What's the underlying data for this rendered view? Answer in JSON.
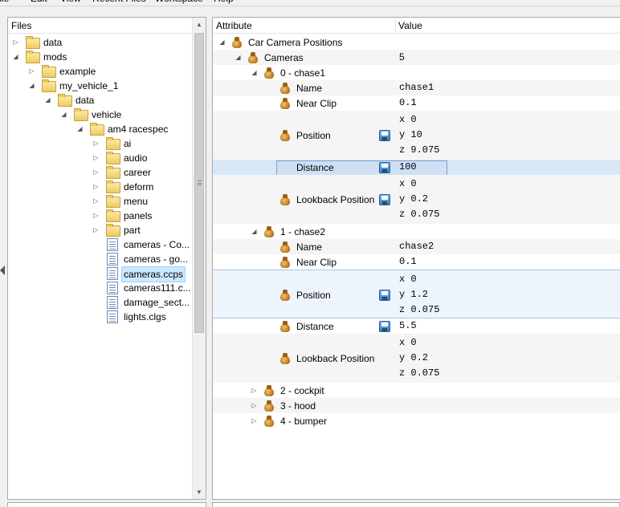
{
  "menu": [
    "File",
    "Edit",
    "View",
    "Recent Files",
    "Workspace",
    "Help"
  ],
  "files_panel": {
    "title": "Files",
    "items": [
      {
        "label": "data",
        "type": "folder",
        "expander": "collapsed"
      },
      {
        "label": "mods",
        "type": "folder",
        "expander": "expanded"
      },
      {
        "label": "example",
        "type": "folder",
        "expander": "collapsed"
      },
      {
        "label": "my_vehicle_1",
        "type": "folder",
        "expander": "expanded"
      },
      {
        "label": "data",
        "type": "folder",
        "expander": "expanded"
      },
      {
        "label": "vehicle",
        "type": "folder",
        "expander": "expanded"
      },
      {
        "label": "am4 racespec",
        "type": "folder",
        "expander": "expanded"
      },
      {
        "label": "ai",
        "type": "folder",
        "expander": "collapsed"
      },
      {
        "label": "audio",
        "type": "folder",
        "expander": "collapsed"
      },
      {
        "label": "career",
        "type": "folder",
        "expander": "collapsed"
      },
      {
        "label": "deform",
        "type": "folder",
        "expander": "collapsed"
      },
      {
        "label": "menu",
        "type": "folder",
        "expander": "collapsed"
      },
      {
        "label": "panels",
        "type": "folder",
        "expander": "collapsed"
      },
      {
        "label": "part",
        "type": "folder",
        "expander": "collapsed"
      },
      {
        "label": "cameras - Co...",
        "type": "file",
        "expander": "none"
      },
      {
        "label": "cameras - go...",
        "type": "file",
        "expander": "none"
      },
      {
        "label": "cameras.ccps",
        "type": "file",
        "expander": "none",
        "selected": true
      },
      {
        "label": "cameras111.c...",
        "type": "file",
        "expander": "none"
      },
      {
        "label": "damage_sect...",
        "type": "file",
        "expander": "none"
      },
      {
        "label": "lights.clgs",
        "type": "file",
        "expander": "none"
      }
    ]
  },
  "attributes_panel": {
    "col_attribute": "Attribute",
    "col_value": "Value",
    "rows": [
      {
        "name": "Car Camera Positions",
        "value": [],
        "expander": "expanded",
        "icon": "bag-icon"
      },
      {
        "name": "Cameras",
        "value": [
          "5"
        ],
        "expander": "expanded",
        "icon": "bag-icon"
      },
      {
        "name": "0 - chase1",
        "value": [],
        "expander": "expanded",
        "icon": "bag-icon"
      },
      {
        "name": "Name",
        "value": [
          "chase1"
        ],
        "expander": "none",
        "icon": "bag-icon"
      },
      {
        "name": "Near Clip",
        "value": [
          "0.1"
        ],
        "expander": "none",
        "icon": "bag-icon"
      },
      {
        "name": "Position",
        "value": [
          "x 0",
          "y 10",
          "z 9.075"
        ],
        "expander": "none",
        "icon": "bag-icon",
        "save": true
      },
      {
        "name": "Distance",
        "value": [
          "100"
        ],
        "expander": "none",
        "icon": "bag-icon-grey",
        "save": true,
        "selected": true
      },
      {
        "name": "Lookback Position",
        "value": [
          "x 0",
          "y 0.2",
          "z 0.075"
        ],
        "expander": "none",
        "icon": "bag-icon",
        "save": true
      },
      {
        "name": "1 - chase2",
        "value": [],
        "expander": "expanded",
        "icon": "bag-icon"
      },
      {
        "name": "Name",
        "value": [
          "chase2"
        ],
        "expander": "none",
        "icon": "bag-icon"
      },
      {
        "name": "Near Clip",
        "value": [
          "0.1"
        ],
        "expander": "none",
        "icon": "bag-icon"
      },
      {
        "name": "Position",
        "value": [
          "x 0",
          "y 1.2",
          "z 0.075"
        ],
        "expander": "none",
        "icon": "bag-icon",
        "save": true,
        "hover": true
      },
      {
        "name": "Distance",
        "value": [
          "5.5"
        ],
        "expander": "none",
        "icon": "bag-icon",
        "save": true
      },
      {
        "name": "Lookback Position",
        "value": [
          "x 0",
          "y 0.2",
          "z 0.075"
        ],
        "expander": "none",
        "icon": "bag-icon"
      },
      {
        "name": "2 - cockpit",
        "value": [],
        "expander": "collapsed",
        "icon": "bag-icon"
      },
      {
        "name": "3 - hood",
        "value": [],
        "expander": "collapsed",
        "icon": "bag-icon"
      },
      {
        "name": "4 - bumper",
        "value": [],
        "expander": "collapsed",
        "icon": "bag-icon"
      }
    ]
  },
  "colors": {
    "selection_bg": "#cce8ff",
    "row_highlight": "#d9e8f7",
    "folder": "#eecb62"
  }
}
